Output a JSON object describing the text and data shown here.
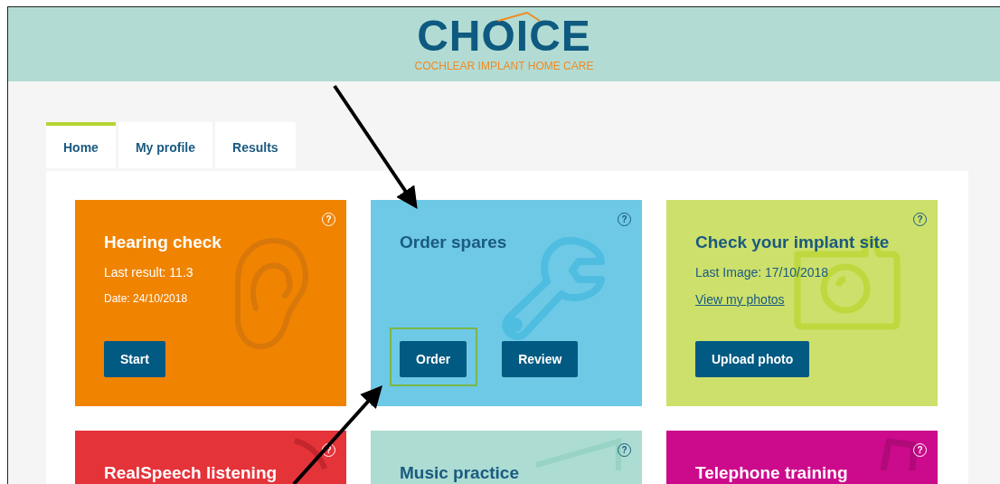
{
  "header": {
    "logo": "CHOICE",
    "tagline": "COCHLEAR IMPLANT HOME CARE"
  },
  "tabs": [
    {
      "label": "Home",
      "selected": true
    },
    {
      "label": "My profile",
      "selected": false
    },
    {
      "label": "Results",
      "selected": false
    }
  ],
  "cards": [
    {
      "title": "Hearing check",
      "color": "#f08300",
      "help": "?",
      "lines": [
        {
          "kind": "text",
          "text": "Last result: 11.3"
        },
        {
          "kind": "small",
          "text": "Date: 24/10/2018"
        }
      ],
      "buttons": [
        {
          "label": "Start",
          "highlighted": false
        }
      ]
    },
    {
      "title": "Order spares",
      "color": "#6ec9e6",
      "help": "?",
      "buttons": [
        {
          "label": "Order",
          "highlighted": true
        },
        {
          "label": "Review",
          "highlighted": false
        }
      ]
    },
    {
      "title": "Check your implant site",
      "color": "#cde06b",
      "help": "?",
      "lines": [
        {
          "kind": "text",
          "text": "Last Image: 17/10/2018"
        },
        {
          "kind": "link",
          "text": "View my photos"
        }
      ],
      "buttons": [
        {
          "label": "Upload photo",
          "highlighted": false
        }
      ]
    },
    {
      "title": "RealSpeech listening",
      "color": "#e5333a",
      "help": "?"
    },
    {
      "title": "Music practice",
      "color": "#acdcd2",
      "help": "?"
    },
    {
      "title": "Telephone training",
      "color": "#cc0a8c",
      "help": "?"
    }
  ]
}
